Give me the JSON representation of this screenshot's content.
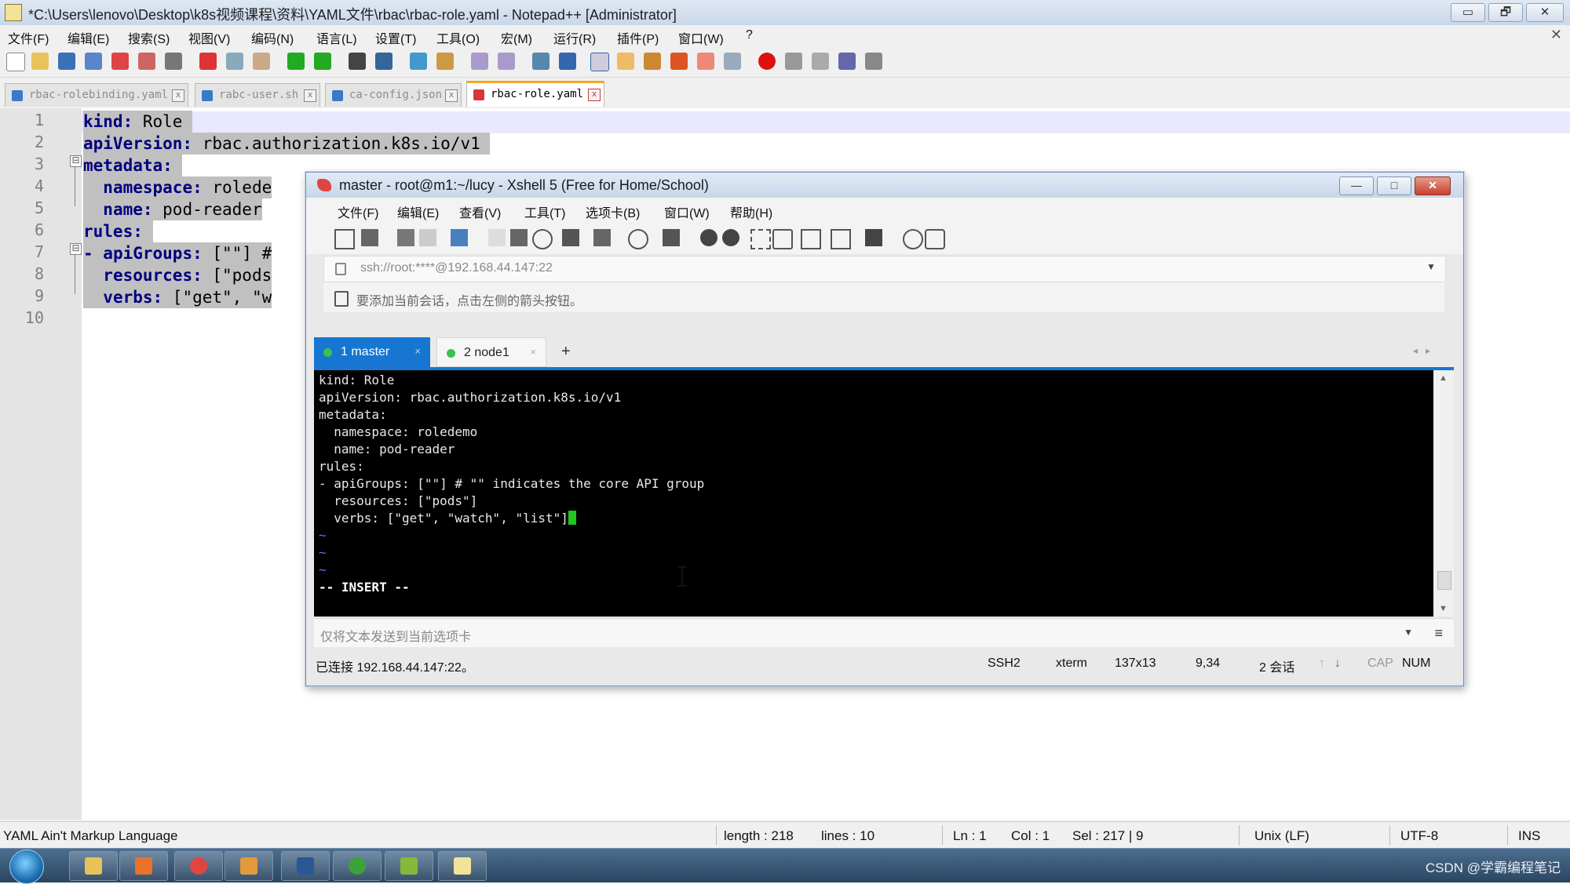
{
  "notepad": {
    "title": "*C:\\Users\\lenovo\\Desktop\\k8s视频课程\\资料\\YAML文件\\rbac\\rbac-role.yaml - Notepad++ [Administrator]",
    "window_buttons": {
      "minimize": "▭",
      "restore": "🗗",
      "close": "✕"
    },
    "menu": [
      "文件(F)",
      "编辑(E)",
      "搜索(S)",
      "视图(V)",
      "编码(N)",
      "语言(L)",
      "设置(T)",
      "工具(O)",
      "宏(M)",
      "运行(R)",
      "插件(P)",
      "窗口(W)",
      "?"
    ],
    "menu_close": "✕",
    "tabs": [
      {
        "label": "rbac-rolebinding.yaml",
        "close": "x",
        "active": false
      },
      {
        "label": "rabc-user.sh",
        "close": "x",
        "active": false
      },
      {
        "label": "ca-config.json",
        "close": "x",
        "active": false
      },
      {
        "label": "rbac-role.yaml",
        "close": "x",
        "active": true
      }
    ],
    "line_numbers": [
      "1",
      "2",
      "3",
      "4",
      "5",
      "6",
      "7",
      "8",
      "9",
      "10"
    ],
    "fold_markers": [
      "⊟",
      "⊟"
    ],
    "code": {
      "l1_key": "kind:",
      "l1_val": " Role",
      "l2_key": "apiVersion:",
      "l2_val": " rbac.authorization.k8s.io/v1",
      "l3_key": "metadata:",
      "l4_key": "namespace:",
      "l4_val": " rolede",
      "l5_key": "name:",
      "l5_val": " pod-reader",
      "l6_key": "rules:",
      "l7_key": "apiGroups:",
      "l7_val": " [\"\"] #",
      "l8_key": "resources:",
      "l8_val": " [\"pods",
      "l9_key": "verbs:",
      "l9_val": " [\"get\", \"w"
    },
    "status": {
      "language": "YAML Ain't Markup Language",
      "length": "length : 218",
      "lines": "lines : 10",
      "ln": "Ln : 1",
      "col": "Col : 1",
      "sel": "Sel : 217 | 9",
      "eol": "Unix (LF)",
      "encoding": "UTF-8",
      "mode": "INS"
    }
  },
  "xshell": {
    "title": "master - root@m1:~/lucy - Xshell 5 (Free for Home/School)",
    "window_buttons": {
      "minimize": "—",
      "maximize": "□",
      "close": "✕"
    },
    "menu": [
      "文件(F)",
      "编辑(E)",
      "查看(V)",
      "工具(T)",
      "选项卡(B)",
      "窗口(W)",
      "帮助(H)"
    ],
    "address": "ssh://root:****@192.168.44.147:22",
    "hint": "要添加当前会话，点击左侧的箭头按钮。",
    "tabs": [
      {
        "label": "1 master",
        "close": "×"
      },
      {
        "label": "2 node1",
        "close": "×"
      }
    ],
    "tab_add": "+",
    "tab_nav": "◂▸",
    "terminal_lines": [
      "kind: Role",
      "apiVersion: rbac.authorization.k8s.io/v1",
      "metadata:",
      "  namespace: roledemo",
      "  name: pod-reader",
      "rules:",
      "- apiGroups: [\"\"] # \"\" indicates the core API group",
      "  resources: [\"pods\"]",
      "  verbs: [\"get\", \"watch\", \"list\"]"
    ],
    "tilde": "~",
    "insert_mode": "-- INSERT --",
    "send_placeholder": "仅将文本发送到当前选项卡",
    "send_menu": "≡",
    "status": {
      "connected": "已连接 192.168.44.147:22。",
      "protocol": "SSH2",
      "term": "xterm",
      "size": "137x13",
      "cursor": "9,34",
      "sessions": "2 会话",
      "cap": "CAP",
      "num": "NUM"
    }
  },
  "taskbar": {
    "tray_text": "CSDN @学霸编程笔记"
  }
}
